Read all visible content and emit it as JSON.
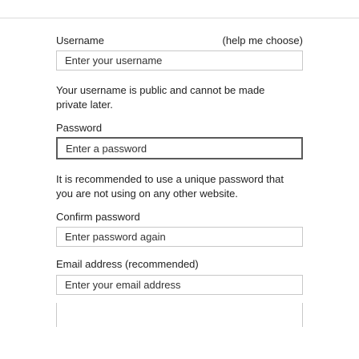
{
  "form": {
    "username": {
      "label": "Username",
      "help_link": "(help me choose)",
      "placeholder": "Enter your username",
      "hint": "Your username is public and cannot be made private later."
    },
    "password": {
      "label": "Password",
      "placeholder": "Enter a password",
      "hint": "It is recommended to use a unique password that you are not using on any other website."
    },
    "confirm_password": {
      "label": "Confirm password",
      "placeholder": "Enter password again"
    },
    "email": {
      "label": "Email address (recommended)",
      "placeholder": "Enter your email address"
    }
  }
}
